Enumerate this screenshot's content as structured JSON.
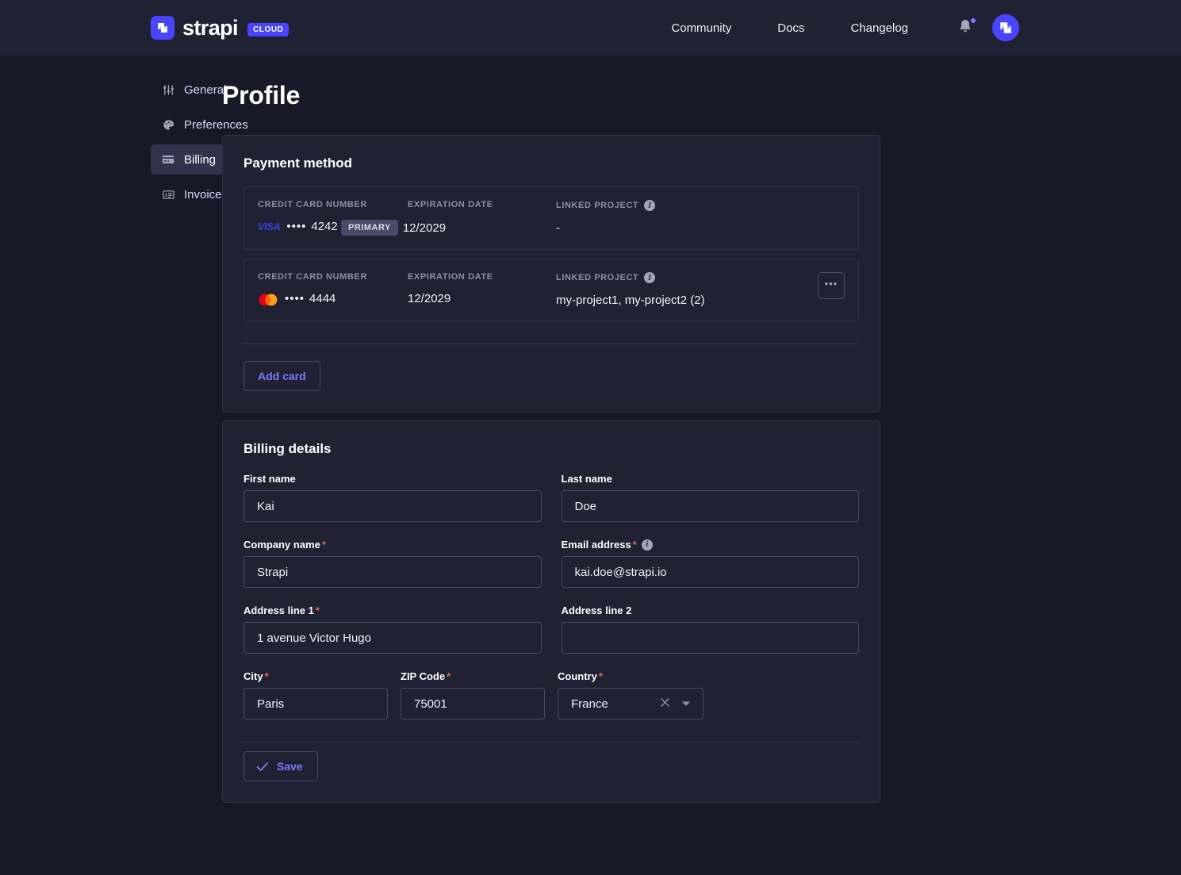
{
  "header": {
    "brand_name": "strapi",
    "brand_badge": "CLOUD",
    "nav": [
      {
        "label": "Community"
      },
      {
        "label": "Docs"
      },
      {
        "label": "Changelog"
      }
    ]
  },
  "sidebar": {
    "items": [
      {
        "label": "General",
        "icon": "sliders-icon",
        "active": false
      },
      {
        "label": "Preferences",
        "icon": "palette-icon",
        "active": false
      },
      {
        "label": "Billing",
        "icon": "credit-card-icon",
        "active": true
      },
      {
        "label": "Invoices",
        "icon": "invoice-icon",
        "active": false
      }
    ]
  },
  "page": {
    "title": "Profile"
  },
  "payment_method": {
    "title": "Payment method",
    "labels": {
      "card_number": "CREDIT CARD NUMBER",
      "expiration": "EXPIRATION DATE",
      "linked_project": "LINKED PROJECT"
    },
    "cards": [
      {
        "brand": "visa",
        "brand_text": "VISA",
        "mask": "••••",
        "last4": "4242",
        "badge": "PRIMARY",
        "expiration": "12/2029",
        "linked_project": "-",
        "has_more_menu": false
      },
      {
        "brand": "mastercard",
        "brand_text": "",
        "mask": "••••",
        "last4": "4444",
        "badge": "",
        "expiration": "12/2029",
        "linked_project": "my-project1, my-project2 (2)",
        "has_more_menu": true,
        "more_label": "•••"
      }
    ],
    "add_card_label": "Add card"
  },
  "billing_details": {
    "title": "Billing details",
    "fields": {
      "first_name": {
        "label": "First name",
        "value": "Kai",
        "required": false
      },
      "last_name": {
        "label": "Last name",
        "value": "Doe",
        "required": false
      },
      "company_name": {
        "label": "Company name",
        "value": "Strapi",
        "required": true
      },
      "email_address": {
        "label": "Email address",
        "value": "kai.doe@strapi.io",
        "required": true,
        "has_info": true
      },
      "address_line_1": {
        "label": "Address line 1",
        "value": "1 avenue Victor Hugo",
        "required": true
      },
      "address_line_2": {
        "label": "Address line 2",
        "value": "",
        "required": false
      },
      "city": {
        "label": "City",
        "value": "Paris",
        "required": true
      },
      "zip_code": {
        "label": "ZIP Code",
        "value": "75001",
        "required": true
      },
      "country": {
        "label": "Country",
        "value": "France",
        "required": true
      }
    },
    "save_label": "Save"
  },
  "colors": {
    "page_bg": "#181826",
    "card_bg": "#212134",
    "border": "#32324d",
    "accent": "#4945ff",
    "accent_text": "#7b79ff",
    "required": "#ee5e52",
    "muted": "#8e8ea9"
  }
}
